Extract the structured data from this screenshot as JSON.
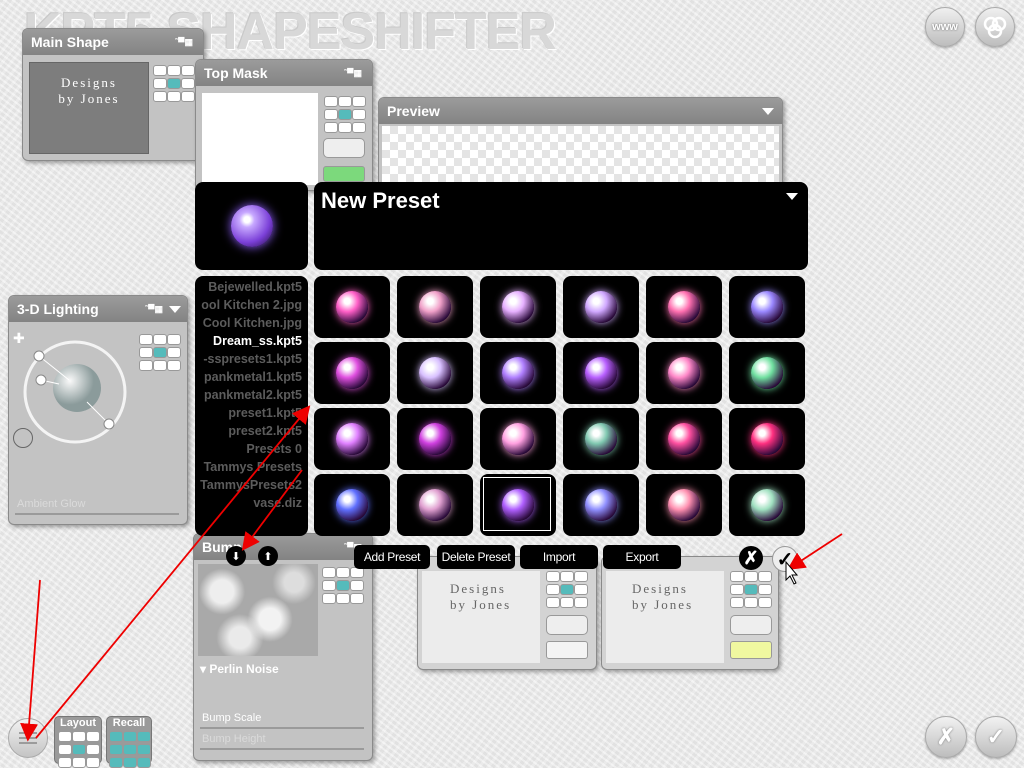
{
  "app": {
    "logo_text": "KPT5 SHAPESHIFTER"
  },
  "top_buttons": {
    "www": "www",
    "brand_icon": "kpt-logo-icon"
  },
  "main_shape": {
    "title": "Main Shape",
    "collapse_glyph": "˜▀▦",
    "preview_text": "Designs by Jones"
  },
  "top_mask": {
    "title": "Top Mask",
    "collapse_glyph": "˜▀▦"
  },
  "preview": {
    "title": "Preview"
  },
  "lighting": {
    "title": "3-D Lighting",
    "collapse_glyph": "˜▀▦",
    "ambient_label": "Ambient Glow"
  },
  "bump": {
    "title": "Bump",
    "collapse_glyph": "˜▀▦",
    "type_label": "Perlin Noise",
    "scale_label": "Bump Scale",
    "height_label": "Bump Height"
  },
  "preset": {
    "name": "New Preset",
    "files": [
      "Bejewelled.kpt5",
      "ool Kitchen 2.jpg",
      "Cool Kitchen.jpg",
      "Dream_ss.kpt5",
      "-sspresets1.kpt5",
      "pankmetal1.kpt5",
      "pankmetal2.kpt5",
      "preset1.kpt5",
      "preset2.kpt5",
      "Presets 0",
      "Tammys Presets",
      "TammysPresets2",
      "vase.diz"
    ],
    "active_file_index": 3,
    "orbs": [
      [
        "#ff5fc7",
        "#f0a0c8",
        "#e6b0ff",
        "#d0a8ff",
        "#ff70b0",
        "#9a88ff"
      ],
      [
        "#e050e0",
        "#d8c0ff",
        "#b080ff",
        "#b860ff",
        "#ff88c8",
        "#70e0a0"
      ],
      [
        "#e080ff",
        "#d040e0",
        "#ffa0e0",
        "#80c8b0",
        "#ff50a0",
        "#ff3080"
      ],
      [
        "#6070ff",
        "#e0a0d0",
        "#b060ff",
        "#9090ff",
        "#ff90b0",
        "#a0e0c0"
      ]
    ],
    "selected_row": 3,
    "selected_col": 2,
    "buttons": {
      "add": "Add Preset",
      "delete": "Delete Preset",
      "import": "Import",
      "export": "Export"
    },
    "cancel_glyph": "✗",
    "ok_glyph": "✓",
    "down_arrow": "⬇",
    "up_arrow": "⬆"
  },
  "mini_panels": {
    "a_text": "Designs by Jones",
    "b_text": "Designs by Jones"
  },
  "bottom": {
    "layout_label": "Layout",
    "recall_label": "Recall",
    "cancel_glyph": "✗",
    "ok_glyph": "✓"
  }
}
